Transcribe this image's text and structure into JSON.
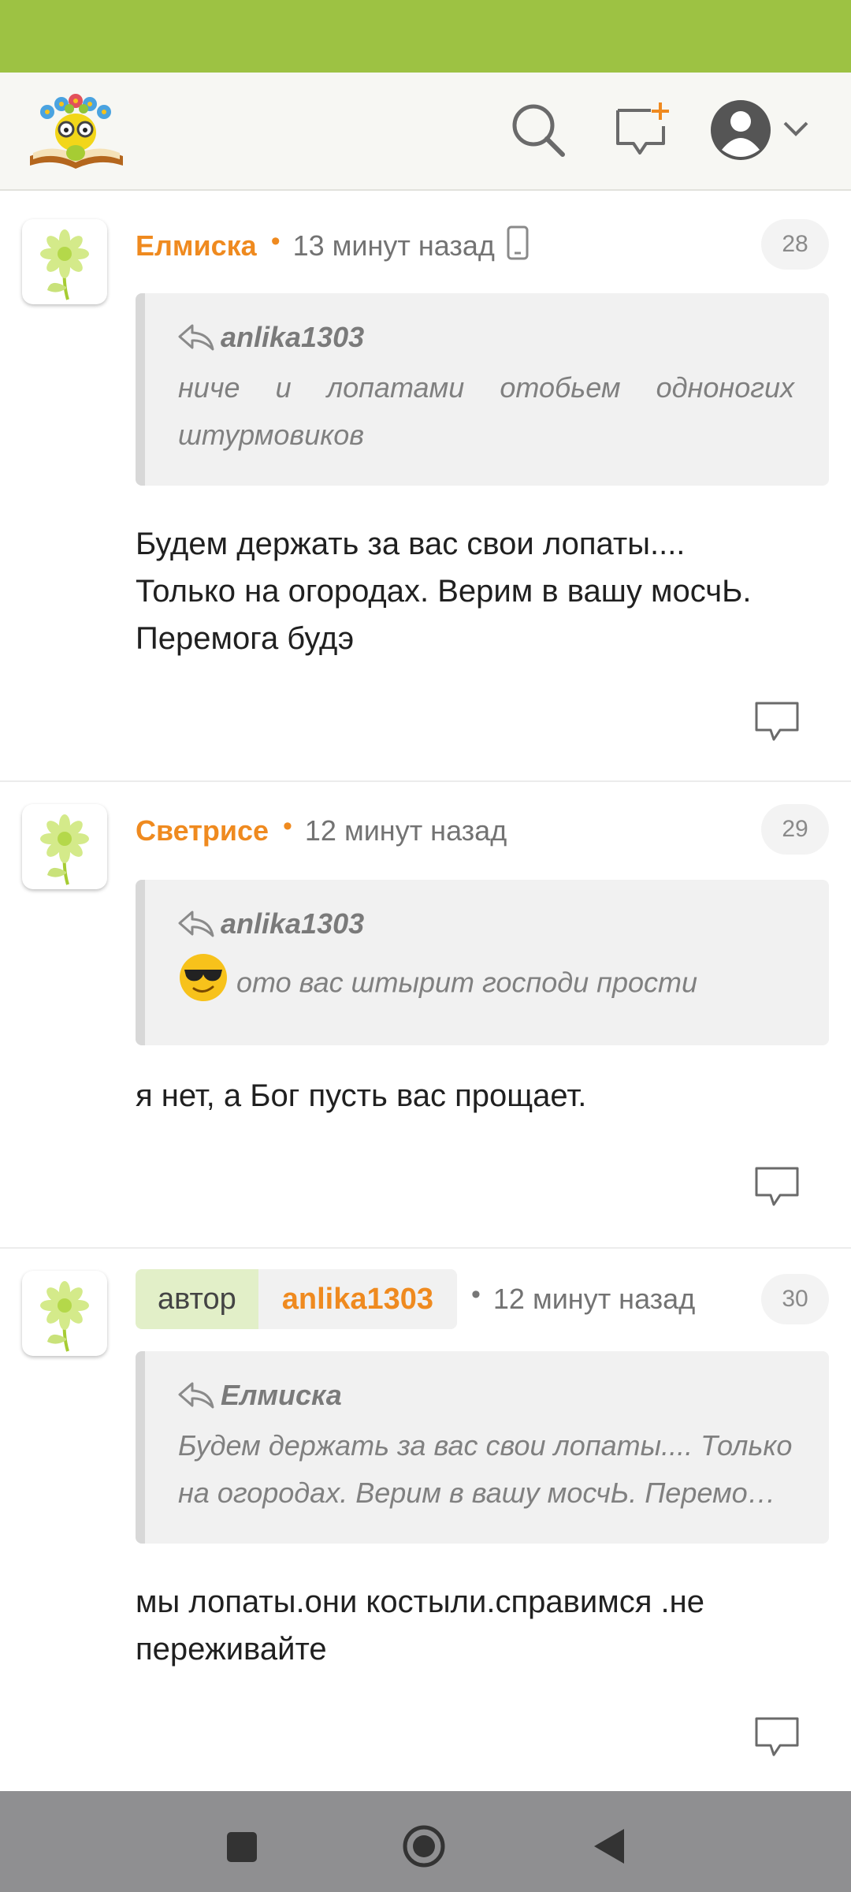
{
  "app": {
    "logo_icon": "reading-bookworm-logo-icon",
    "icons": [
      "search-icon",
      "new-message-icon",
      "profile-icon",
      "chevron-down-icon"
    ]
  },
  "comments": [
    {
      "author": "Елмиска",
      "time": "13 минут назад",
      "device_icon": "phone-icon",
      "number": "28",
      "quote": {
        "author": "anlika1303",
        "text": "ниче и лопатами отобьем одноногих штурмовиков"
      },
      "lines": [
        "Будем держать за вас свои лопаты....",
        "Только на огородах. Верим в вашу мосчЬ.",
        "Перемога будэ"
      ]
    },
    {
      "author": "Светрисе",
      "time": "12 минут назад",
      "number": "29",
      "quote": {
        "author": "anlika1303",
        "emoji": "sunglasses-emoji",
        "text": "ото вас штырит господи прости"
      },
      "lines": [
        "я нет, а Бог пусть вас прощает."
      ]
    },
    {
      "author_label": "автор",
      "author": "anlika1303",
      "time": "12 минут назад",
      "number": "30",
      "quote": {
        "author": "Елмиска",
        "lines": [
          "Будем держать за вас свои лопаты.... Только",
          "на огородах. Верим в вашу мосчЬ. Перемо…"
        ]
      },
      "lines": [
        "мы лопаты.они костыли.справимся .не",
        "переживайте"
      ]
    }
  ],
  "colors": {
    "status_bar": "#9dc243",
    "username": "#ef8a1f",
    "author_label_bg": "#e2efc8",
    "quote_bg": "#f1f1f1",
    "nav_bar": "#8f8f91"
  }
}
